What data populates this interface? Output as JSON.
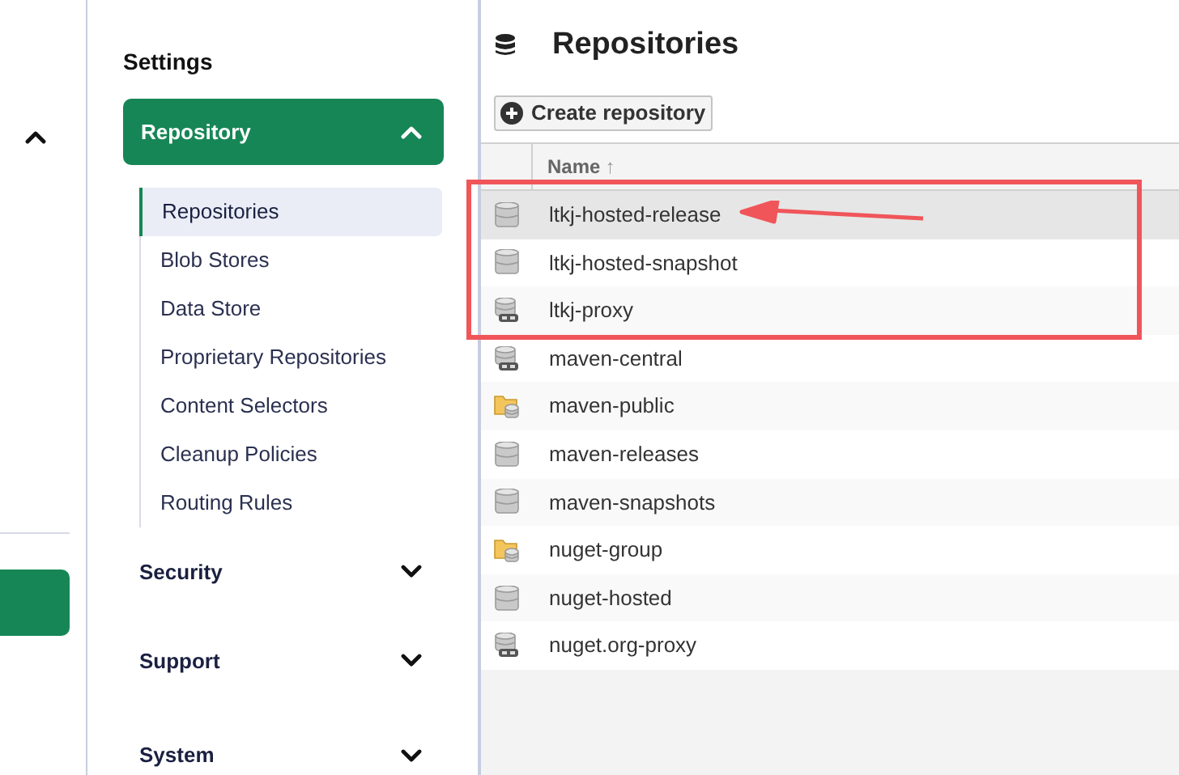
{
  "settings": {
    "title": "Settings",
    "sections": [
      {
        "label": "Repository",
        "expanded": true,
        "items": [
          {
            "label": "Repositories",
            "selected": true
          },
          {
            "label": "Blob Stores",
            "selected": false
          },
          {
            "label": "Data Store",
            "selected": false
          },
          {
            "label": "Proprietary Repositories",
            "selected": false
          },
          {
            "label": "Content Selectors",
            "selected": false
          },
          {
            "label": "Cleanup Policies",
            "selected": false
          },
          {
            "label": "Routing Rules",
            "selected": false
          }
        ]
      },
      {
        "label": "Security",
        "expanded": false
      },
      {
        "label": "Support",
        "expanded": false
      },
      {
        "label": "System",
        "expanded": false
      }
    ]
  },
  "page": {
    "title": "Repositories",
    "create_button": "Create repository"
  },
  "table": {
    "columns": [
      {
        "label": "Name",
        "sort": "↑"
      }
    ],
    "rows": [
      {
        "name": "ltkj-hosted-release",
        "kind": "hosted",
        "selected": true
      },
      {
        "name": "ltkj-hosted-snapshot",
        "kind": "hosted",
        "selected": false
      },
      {
        "name": "ltkj-proxy",
        "kind": "proxy",
        "selected": false
      },
      {
        "name": "maven-central",
        "kind": "proxy",
        "selected": false
      },
      {
        "name": "maven-public",
        "kind": "group",
        "selected": false
      },
      {
        "name": "maven-releases",
        "kind": "hosted",
        "selected": false
      },
      {
        "name": "maven-snapshots",
        "kind": "hosted",
        "selected": false
      },
      {
        "name": "nuget-group",
        "kind": "group",
        "selected": false
      },
      {
        "name": "nuget-hosted",
        "kind": "hosted",
        "selected": false
      },
      {
        "name": "nuget.org-proxy",
        "kind": "proxy",
        "selected": false
      }
    ]
  }
}
